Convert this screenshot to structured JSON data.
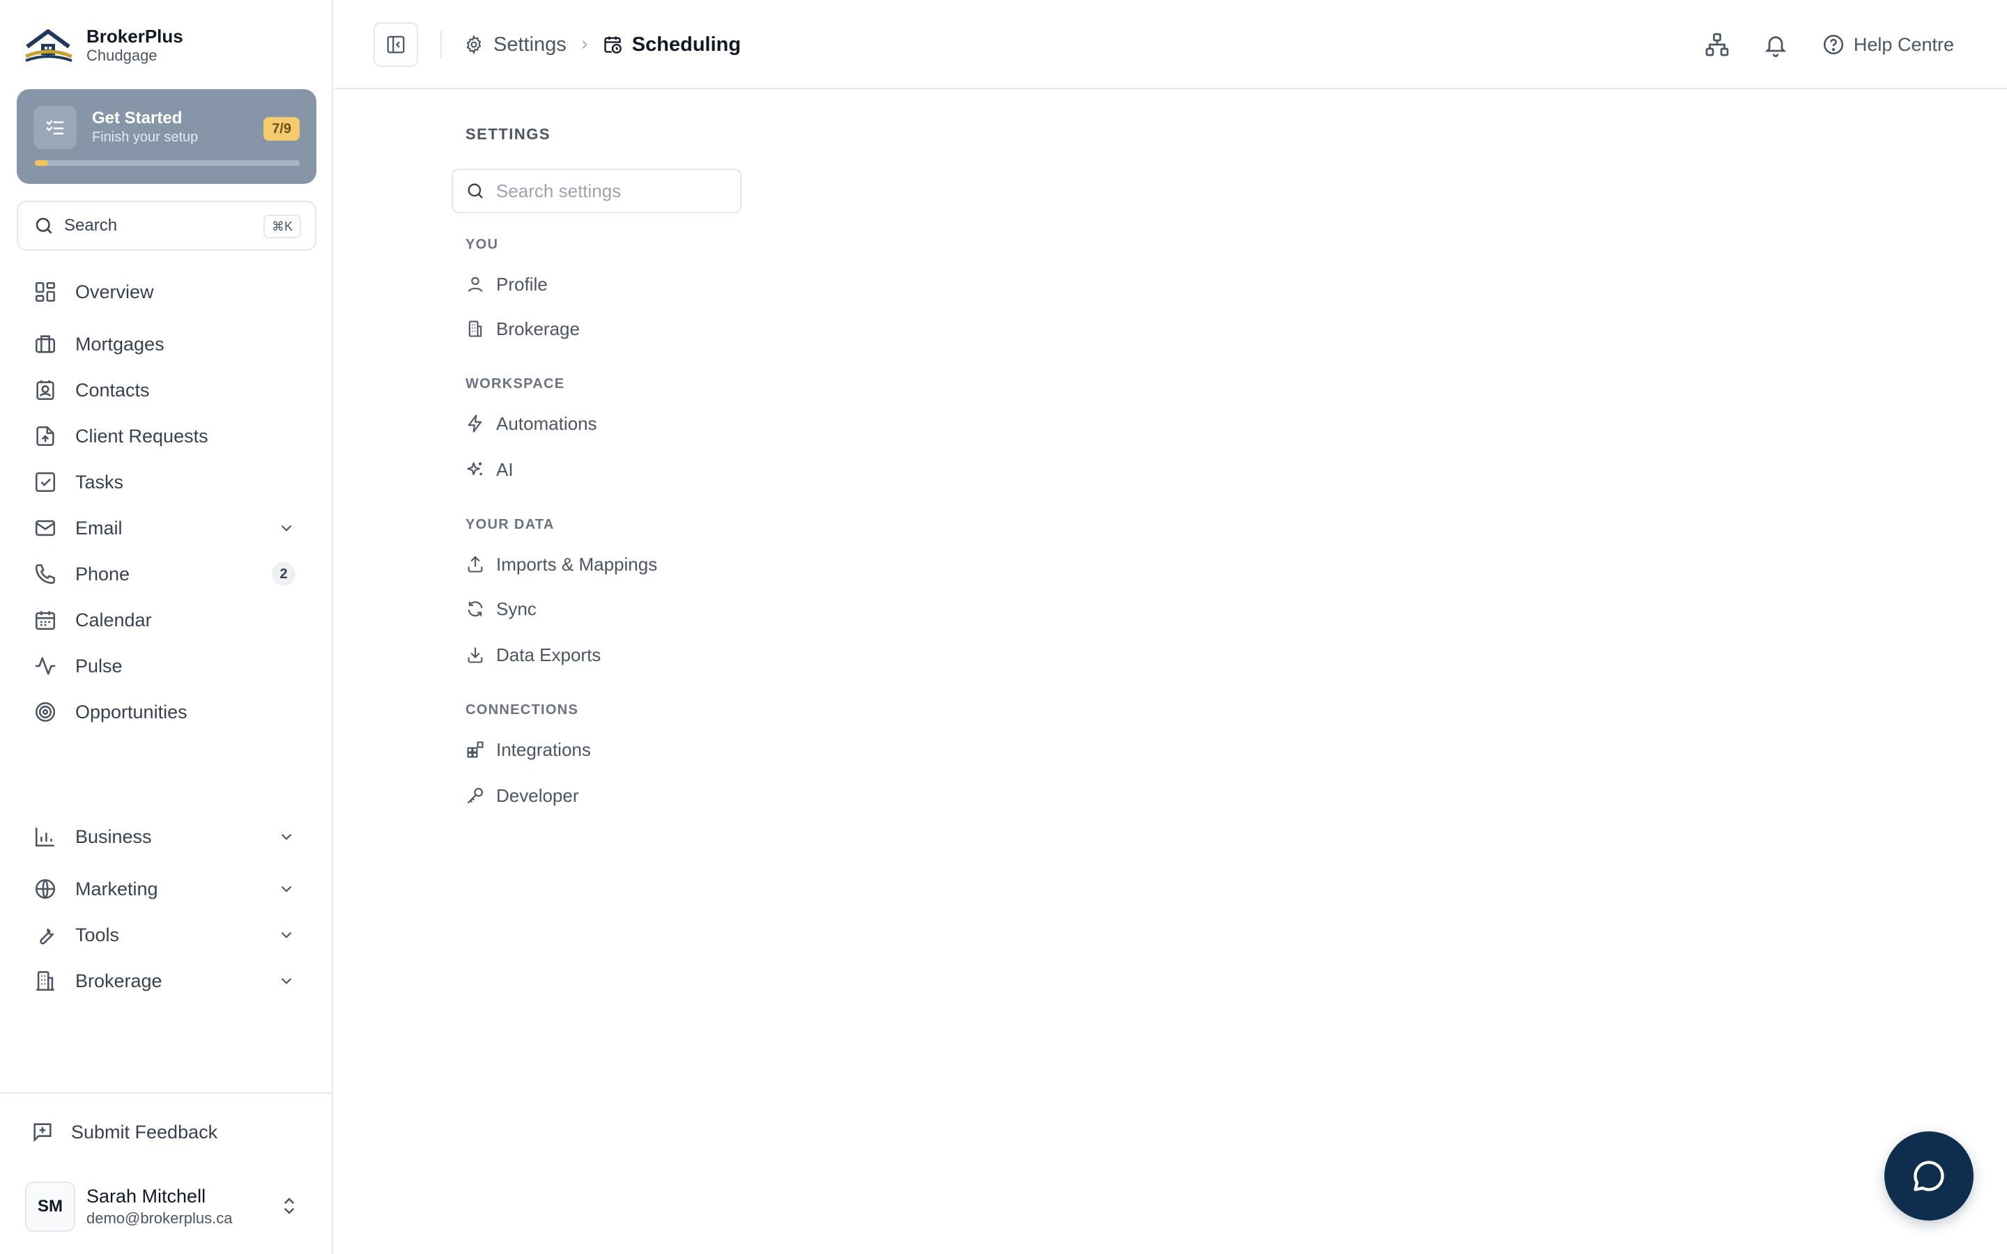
{
  "brand": {
    "name": "BrokerPlus",
    "subtitle": "Chudgage"
  },
  "get_started": {
    "title": "Get Started",
    "subtitle": "Finish your setup",
    "badge": "7/9",
    "progress": 0.05
  },
  "sidebar_search": {
    "label": "Search",
    "shortcut": "⌘K"
  },
  "nav": {
    "overview": "Overview",
    "mortgages": "Mortgages",
    "contacts": "Contacts",
    "client_requests": "Client Requests",
    "tasks": "Tasks",
    "email": "Email",
    "phone": "Phone",
    "phone_count": "2",
    "calendar": "Calendar",
    "pulse": "Pulse",
    "opportunities": "Opportunities",
    "business": "Business",
    "marketing": "Marketing",
    "tools": "Tools",
    "brokerage": "Brokerage"
  },
  "footer": {
    "feedback": "Submit Feedback",
    "user_initials": "SM",
    "user_name": "Sarah Mitchell",
    "user_email": "demo@brokerplus.ca"
  },
  "breadcrumb": {
    "parent": "Settings",
    "current": "Scheduling"
  },
  "top_actions": {
    "help": "Help Centre"
  },
  "settings": {
    "title": "SETTINGS",
    "search_placeholder": "Search settings",
    "groups": {
      "you": "YOU",
      "workspace": "WORKSPACE",
      "your_data": "YOUR DATA",
      "connections": "CONNECTIONS"
    },
    "items": {
      "profile": "Profile",
      "brokerage": "Brokerage",
      "automations": "Automations",
      "ai": "AI",
      "imports": "Imports & Mappings",
      "sync": "Sync",
      "exports": "Data Exports",
      "integrations": "Integrations",
      "developer": "Developer"
    }
  },
  "colors": {
    "accent": "#0f2e4d",
    "get_started_bg": "#8795a8",
    "badge": "#f5cb6d"
  }
}
